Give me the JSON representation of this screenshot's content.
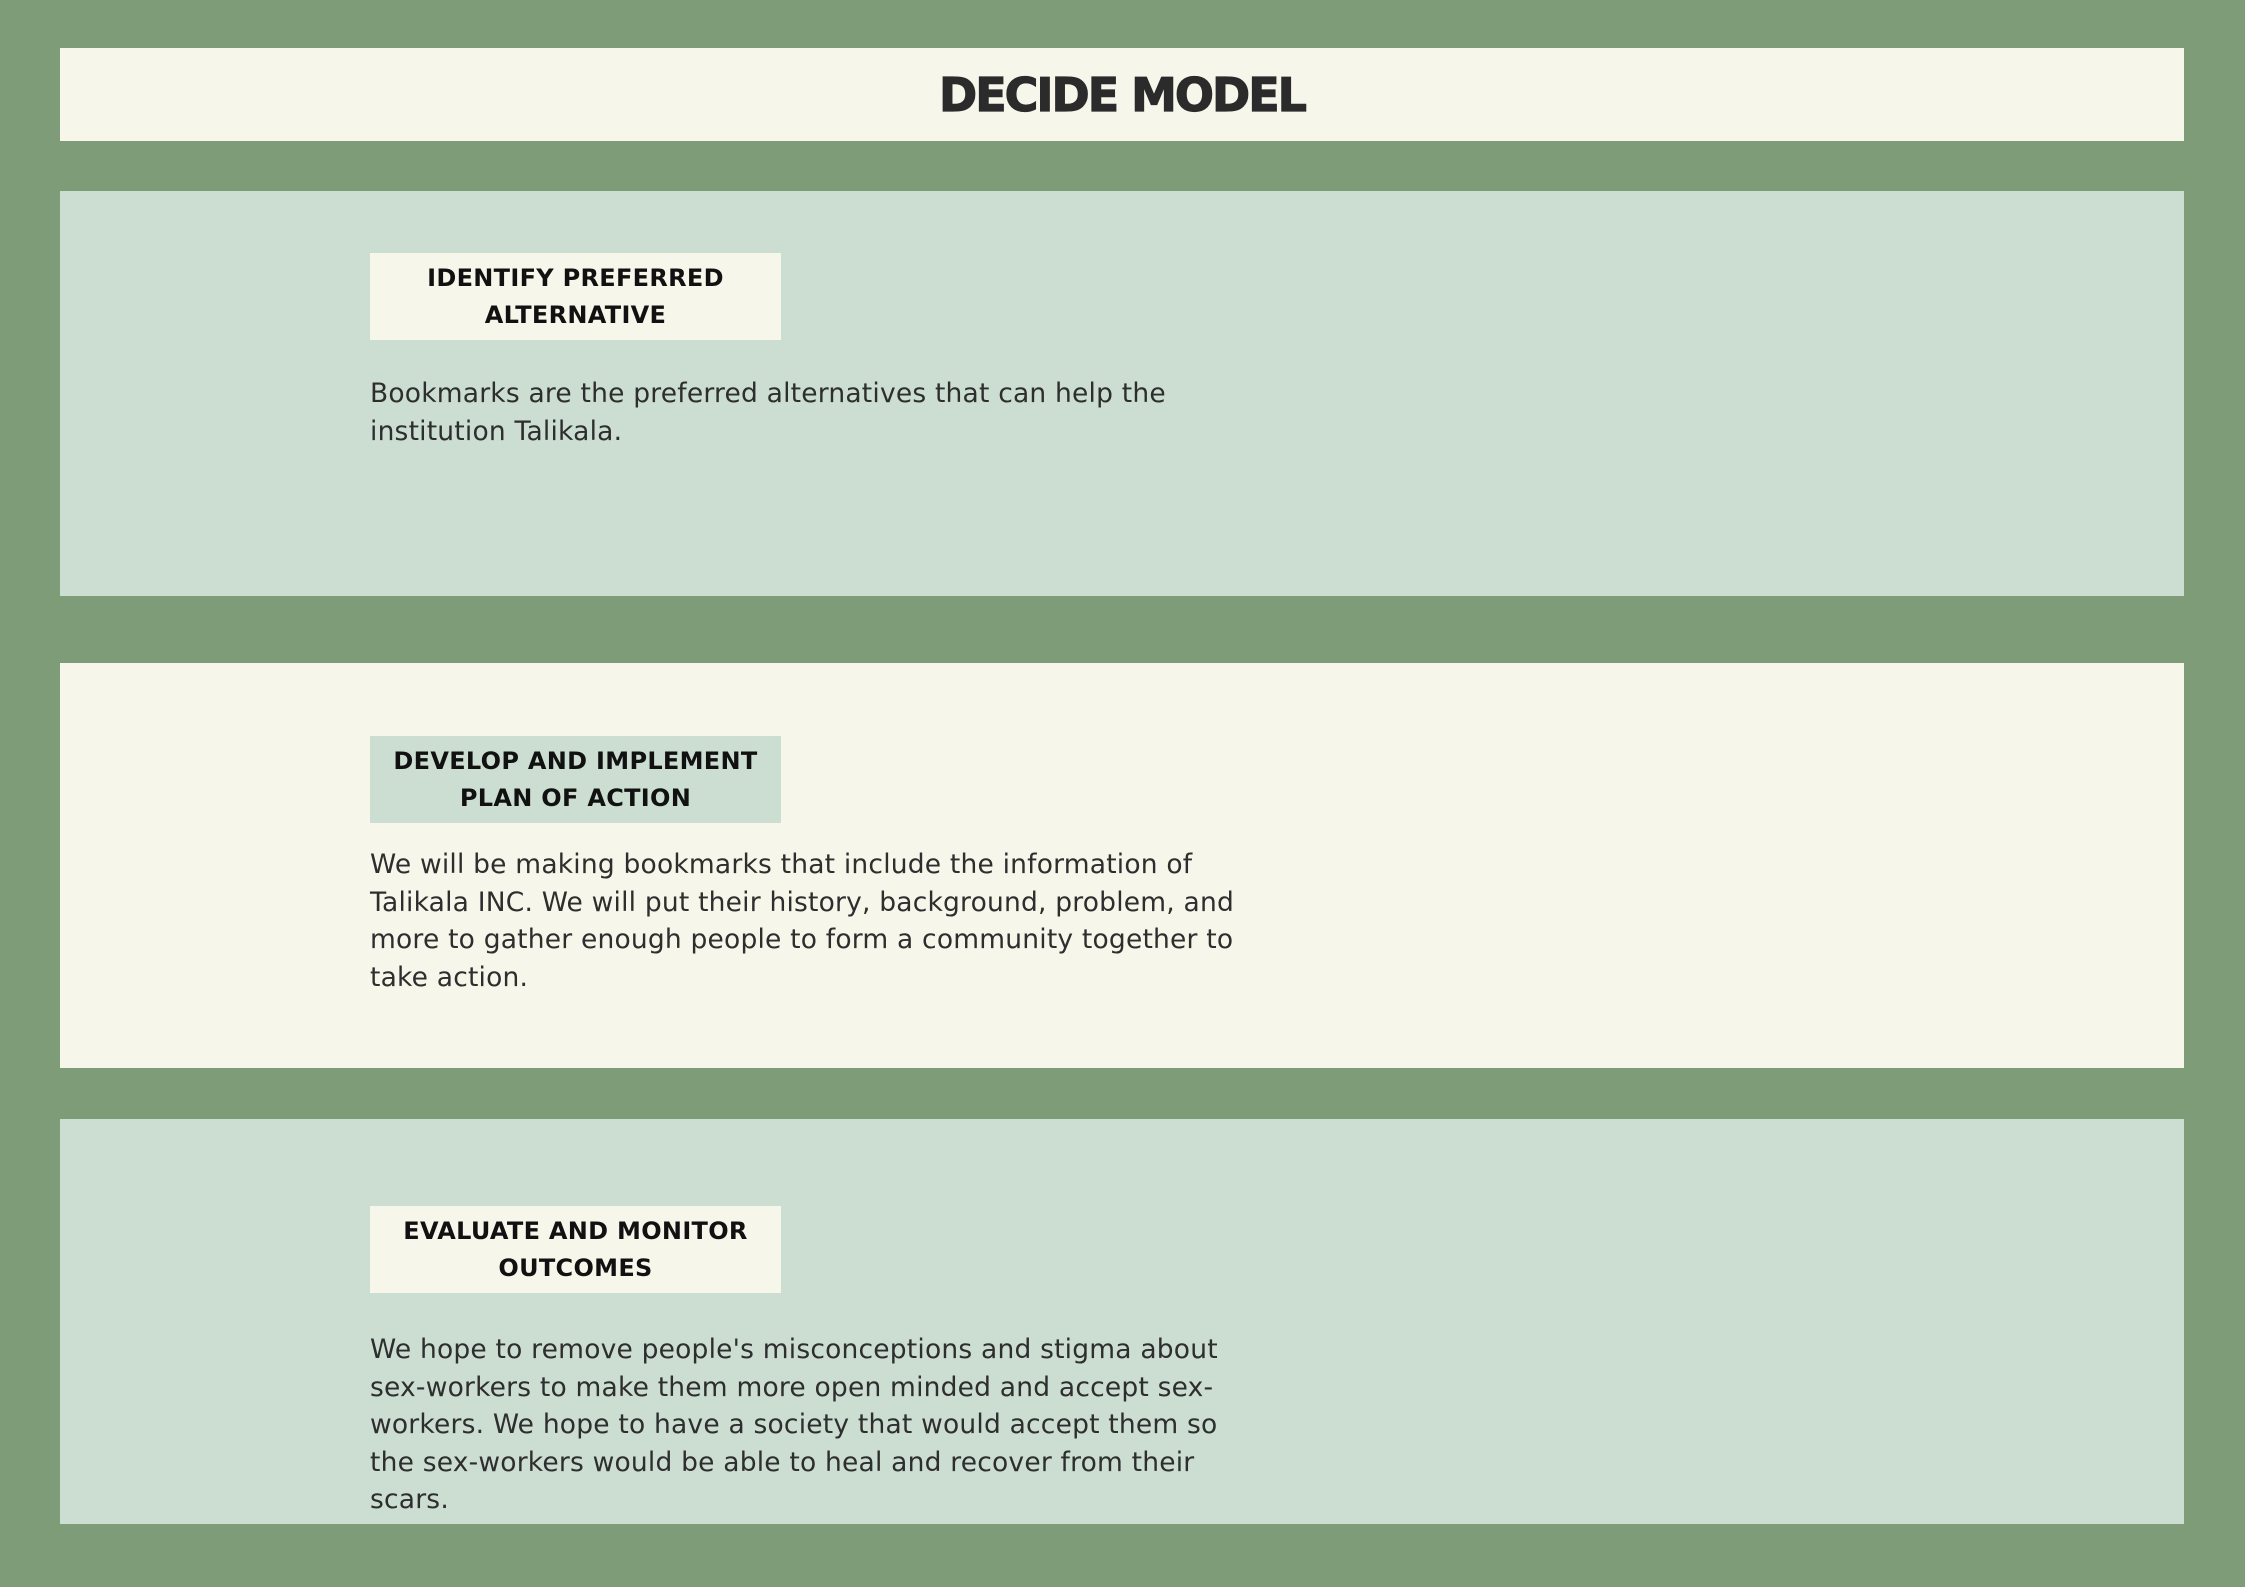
{
  "title": "DECIDE MODEL",
  "sections": [
    {
      "heading": "IDENTIFY PREFERRED ALTERNATIVE",
      "body": "Bookmarks are the preferred alternatives that can help the institution Talikala."
    },
    {
      "heading": "DEVELOP AND IMPLEMENT PLAN OF ACTION",
      "body": "We will be making bookmarks that include the information of Talikala INC. We will put their history, background, problem, and more to gather enough people to form a community together to take action."
    },
    {
      "heading": "EVALUATE AND MONITOR OUTCOMES",
      "body": "We hope to remove people's misconceptions and stigma about sex-workers to make them more open minded and accept sex-workers. We hope to have a society that would accept them so the sex-workers would be able to heal and recover from their scars."
    }
  ],
  "colors": {
    "background": "#7f9c78",
    "cream": "#f6f6ea",
    "mint": "#cbded1",
    "text": "#2e2e2e"
  }
}
